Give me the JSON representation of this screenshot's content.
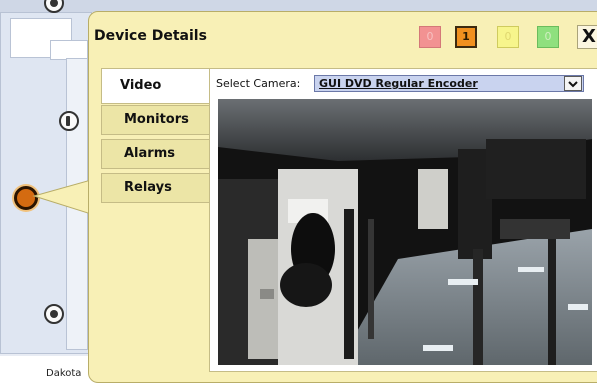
{
  "map": {
    "label": "Dakota"
  },
  "dialog": {
    "title": "Device Details",
    "status_counts": [
      {
        "name": "red",
        "value": "0",
        "color": "#f29292"
      },
      {
        "name": "orange",
        "value": "1",
        "color": "#f0901f"
      },
      {
        "name": "yellow",
        "value": "0",
        "color": "#f7f58c"
      },
      {
        "name": "green",
        "value": "0",
        "color": "#8fe07e"
      }
    ],
    "close_label": "X",
    "tabs": [
      "Video",
      "Monitors",
      "Alarms",
      "Relays"
    ],
    "active_tab": "Video",
    "video": {
      "select_label": "Select Camera:",
      "selected_camera": "GUI DVD Regular Encoder"
    }
  },
  "icons": [
    "map-marker-icon",
    "close-icon",
    "chevron-down-icon"
  ],
  "colors": {
    "dialog_bg": "#f8f0b6",
    "selected_marker": "#d46b11"
  }
}
